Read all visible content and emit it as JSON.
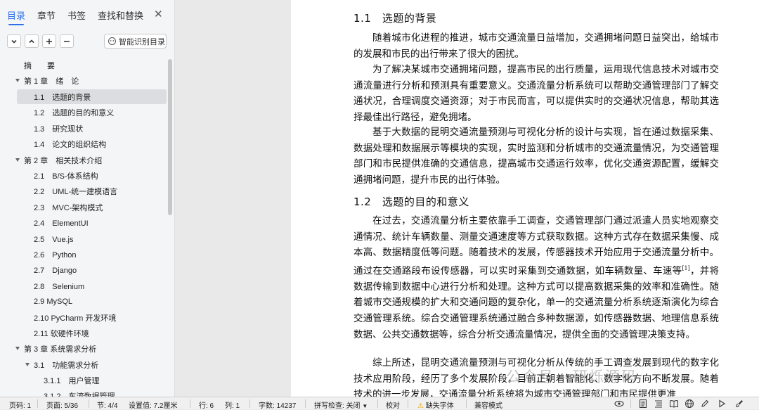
{
  "sidebar": {
    "tabs": [
      "目录",
      "章节",
      "书签",
      "查找和替换"
    ],
    "close_label": "✕",
    "smart_button": "智能识别目录",
    "toc": [
      {
        "label": "摘　　要",
        "indent": 0
      },
      {
        "label": "第 1 章　绪　论",
        "indent": 0,
        "expanded": true
      },
      {
        "label": "1.1　选题的背景",
        "indent": 1,
        "selected": true
      },
      {
        "label": "1.2　选题的目的和意义",
        "indent": 1
      },
      {
        "label": "1.3　研究现状",
        "indent": 1
      },
      {
        "label": "1.4　论文的组织结构",
        "indent": 1
      },
      {
        "label": "第 2 章　相关技术介绍",
        "indent": 0,
        "expanded": true
      },
      {
        "label": "2.1　B/S-体系结构",
        "indent": 1
      },
      {
        "label": "2.2　UML-统一建模语言",
        "indent": 1
      },
      {
        "label": "2.3　MVC-架构模式",
        "indent": 1
      },
      {
        "label": "2.4　ElementUI",
        "indent": 1
      },
      {
        "label": "2.5　Vue.js",
        "indent": 1
      },
      {
        "label": "2.6　Python",
        "indent": 1
      },
      {
        "label": "2.7　Django",
        "indent": 1
      },
      {
        "label": "2.8　Selenium",
        "indent": 1
      },
      {
        "label": "2.9  MySQL",
        "indent": 1
      },
      {
        "label": "2.10  PyCharm 开发环境",
        "indent": 1
      },
      {
        "label": "2.11  软硬件环境",
        "indent": 1
      },
      {
        "label": "第 3 章  系统需求分析",
        "indent": 0,
        "expanded": true
      },
      {
        "label": "3.1　功能需求分析",
        "indent": 1,
        "expanded": true
      },
      {
        "label": "3.1.1　用户管理",
        "indent": 2
      },
      {
        "label": "3.1.2　车流数据管理",
        "indent": 2
      }
    ]
  },
  "document": {
    "heading_tag": "H₂",
    "h1": "1.1　选题的背景",
    "p1": "随着城市化进程的推进，城市交通流量日益增加，交通拥堵问题日益突出，给城市的发展和市民的出行带来了很大的困扰。",
    "p2": "为了解决某城市交通拥堵问题，提高市民的出行质量，运用现代信息技术对城市交通流量进行分析和预测具有重要意义。交通流量分析系统可以帮助交通管理部门了解交通状况，合理调度交通资源；对于市民而言，可以提供实时的交通状况信息，帮助其选择最佳出行路径，避免拥堵。",
    "p3": "基于大数据的昆明交通流量预测与可视化分析的设计与实现，旨在通过数据采集、数据处理和数据展示等模块的实现，实时监测和分析城市的交通流量情况，为交通管理部门和市民提供准确的交通信息，提高城市交通运行效率，优化交通资源配置，缓解交通拥堵问题，提升市民的出行体验。",
    "h2": "1.2　选题的目的和意义",
    "p4a": "在过去，交通流量分析主要依靠手工调查，交通管理部门通过派遣人员实地观察交通情况、统计车辆数量、测量交通速度等方式获取数据。这种方式存在数据采集慢、成本高、数据精度低等问题。随着技术的发展，传感器技术开始应用于交通流量分析中。通过在交通路段布设传感器，可以实时采集到交通数据，如车辆数量、车速等",
    "p4_ref": "[1]",
    "p4b": "，并将数据传输到数据中心进行分析和处理。这种方式可以提高数据采集的效率和准确性。随着城市交通规模的扩大和交通问题的复杂化，单一的交通流量分析系统逐渐演化为综合交通管理系统。综合交通管理系统通过融合多种数据源，如传感器数据、地理信息系统数据、公共交通数据等，综合分析交通流量情况，提供全面的交通管理决策支持。",
    "p5": "综上所述，昆明交通流量预测与可视化分析从传统的手工调查发展到现代的数字化技术应用阶段，经历了多个发展阶段，目前正朝着智能化、数字化方向不断发展。随着技术的进一步发展，交通流量分析系统将为城市交通管理部门和市民提供更准"
  },
  "watermark": "公众号 · 研烁源码",
  "statusbar": {
    "page_code": "页码: 1",
    "page": "页面: 5/36",
    "section": "节: 4/4",
    "setting": "设置值: 7.2厘米",
    "row": "行: 6",
    "col": "列: 1",
    "wordcount": "字数: 14237",
    "spellcheck": "拼写检查: 关闭",
    "proofread": "校对",
    "missing_font": "缺失字体",
    "compat": "兼容模式"
  },
  "colors": {
    "accent": "#2f6fe8",
    "warning": "#e8a100"
  }
}
